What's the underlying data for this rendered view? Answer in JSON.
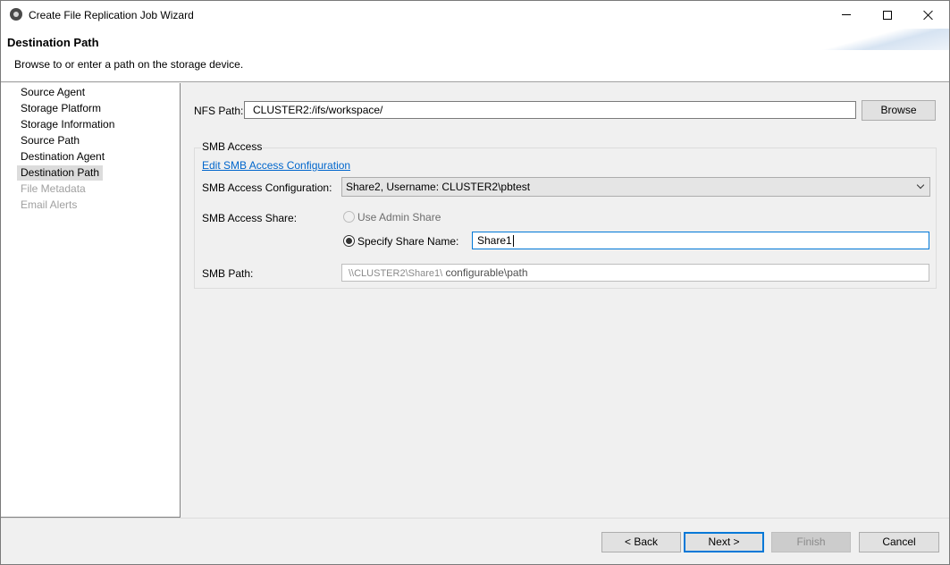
{
  "window": {
    "title": "Create File Replication Job Wizard"
  },
  "header": {
    "title": "Destination Path",
    "description": "Browse to or enter a path on the storage device."
  },
  "nav": {
    "items": [
      {
        "label": "Source Agent",
        "state": "normal"
      },
      {
        "label": "Storage Platform",
        "state": "normal"
      },
      {
        "label": "Storage Information",
        "state": "normal"
      },
      {
        "label": "Source Path",
        "state": "normal"
      },
      {
        "label": "Destination Agent",
        "state": "normal"
      },
      {
        "label": "Destination Path",
        "state": "selected"
      },
      {
        "label": "File Metadata",
        "state": "disabled"
      },
      {
        "label": "Email Alerts",
        "state": "disabled"
      }
    ]
  },
  "nfs": {
    "label": "NFS Path:",
    "value": "CLUSTER2:/ifs/workspace/",
    "browse_label": "Browse"
  },
  "smb": {
    "group_label": "SMB Access",
    "edit_link": "Edit SMB Access Configuration",
    "config_label": "SMB Access Configuration:",
    "config_value": "Share2, Username: CLUSTER2\\pbtest",
    "share_label": "SMB Access Share:",
    "use_admin_label": "Use Admin Share",
    "specify_label": "Specify Share Name:",
    "share_name_value": "Share1",
    "path_label": "SMB Path:",
    "path_prefix": "\\\\CLUSTER2\\Share1\\",
    "path_suffix": " configurable\\path"
  },
  "footer": {
    "back_label": "< Back",
    "next_label": "Next >",
    "finish_label": "Finish",
    "cancel_label": "Cancel"
  },
  "colors": {
    "link": "#0066cc",
    "focus": "#0078d7",
    "selected_nav": "#dcdcdc"
  }
}
